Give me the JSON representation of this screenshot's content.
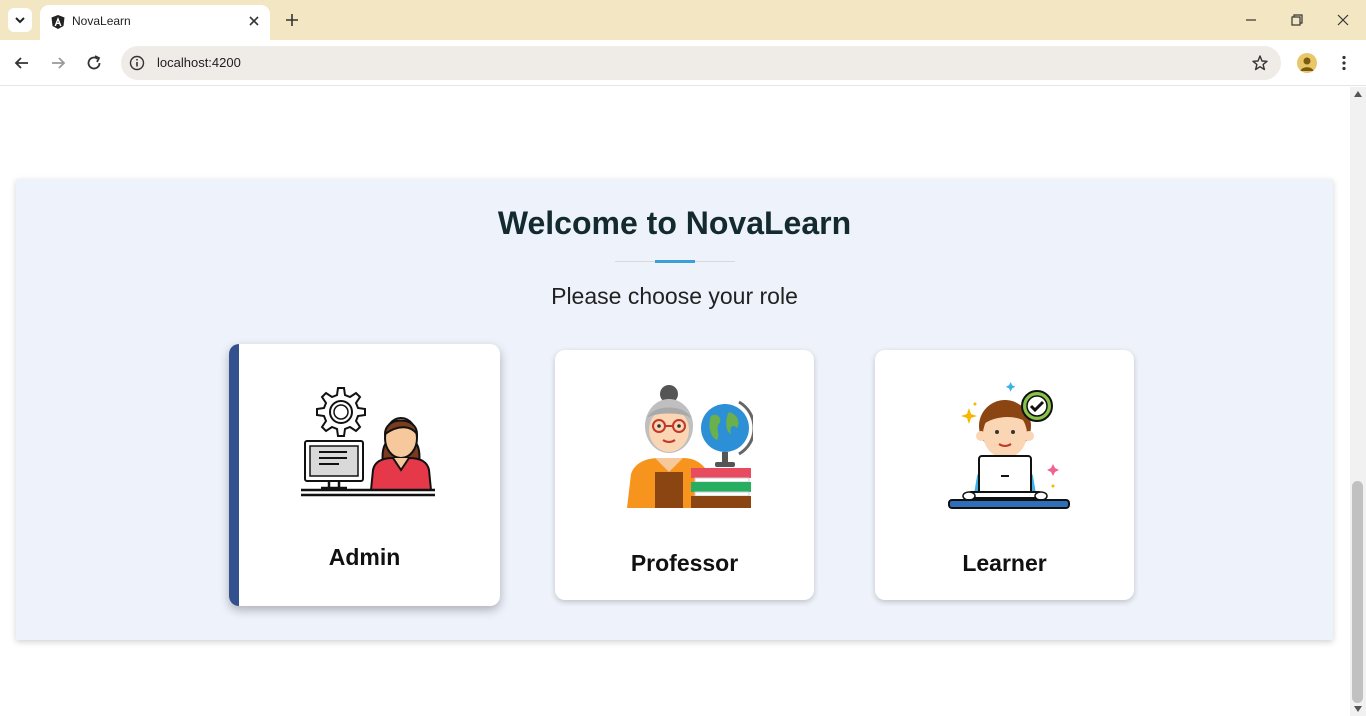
{
  "browser": {
    "tab_title": "NovaLearn",
    "url": "localhost:4200"
  },
  "page": {
    "title": "Welcome to NovaLearn",
    "subtitle": "Please choose your role",
    "roles": [
      {
        "label": "Admin",
        "illustration": "admin-computer-gear-icon"
      },
      {
        "label": "Professor",
        "illustration": "professor-globe-books-icon"
      },
      {
        "label": "Learner",
        "illustration": "learner-laptop-check-icon"
      }
    ]
  },
  "colors": {
    "panel_bg": "#eef2fb",
    "accent_blue": "#3b9fd8",
    "active_card_bar": "#33508f",
    "title_color": "#132a2e"
  }
}
